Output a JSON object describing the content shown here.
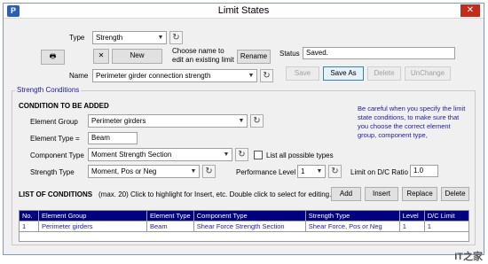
{
  "window": {
    "title": "Limit States",
    "app_icon": "P",
    "close_glyph": "✕"
  },
  "top": {
    "type_label": "Type",
    "type_value": "Strength",
    "new_button": "New",
    "delete_glyph": "✕",
    "edit_hint": "Choose name to edit an existing limit",
    "rename_button": "Rename",
    "name_label": "Name",
    "name_value": "Perimeter girder connection strength",
    "status_label": "Status",
    "status_value": "Saved.",
    "buttons": {
      "save": "Save",
      "save_as": "Save As",
      "delete": "Delete",
      "unchange": "UnChange"
    }
  },
  "strength_conditions": {
    "group_title": "Strength Conditions",
    "section_heading": "CONDITION TO BE ADDED",
    "element_group_label": "Element Group",
    "element_group_value": "Perimeter girders",
    "element_type_label": "Element Type =",
    "element_type_value": "Beam",
    "component_type_label": "Component Type",
    "component_type_value": "Moment Strength Section",
    "list_all_label": "List all possible types",
    "strength_type_label": "Strength Type",
    "strength_type_value": "Moment, Pos or Neg",
    "performance_level_label": "Performance Level",
    "performance_level_value": "1",
    "limit_dc_label": "Limit on D/C Ratio",
    "limit_dc_value": "1.0",
    "note": "Be careful when you specify the limit state conditions, to make sure that you choose the correct element group, component type,"
  },
  "conditions": {
    "heading": "LIST OF CONDITIONS",
    "hint": "(max. 20)  Click to highlight for Insert, etc. Double click to select for editing.",
    "buttons": {
      "add": "Add",
      "insert": "Insert",
      "replace": "Replace",
      "delete": "Delete"
    },
    "columns": [
      "No.",
      "Element Group",
      "Element Type",
      "Component Type",
      "Strength Type",
      "Level",
      "D/C Limit"
    ],
    "rows": [
      [
        "1",
        "Perimeter girders",
        "Beam",
        "Shear Force Strength Section",
        "Shear Force, Pos or Neg",
        "1",
        "1"
      ]
    ]
  },
  "watermark": "IT之家"
}
